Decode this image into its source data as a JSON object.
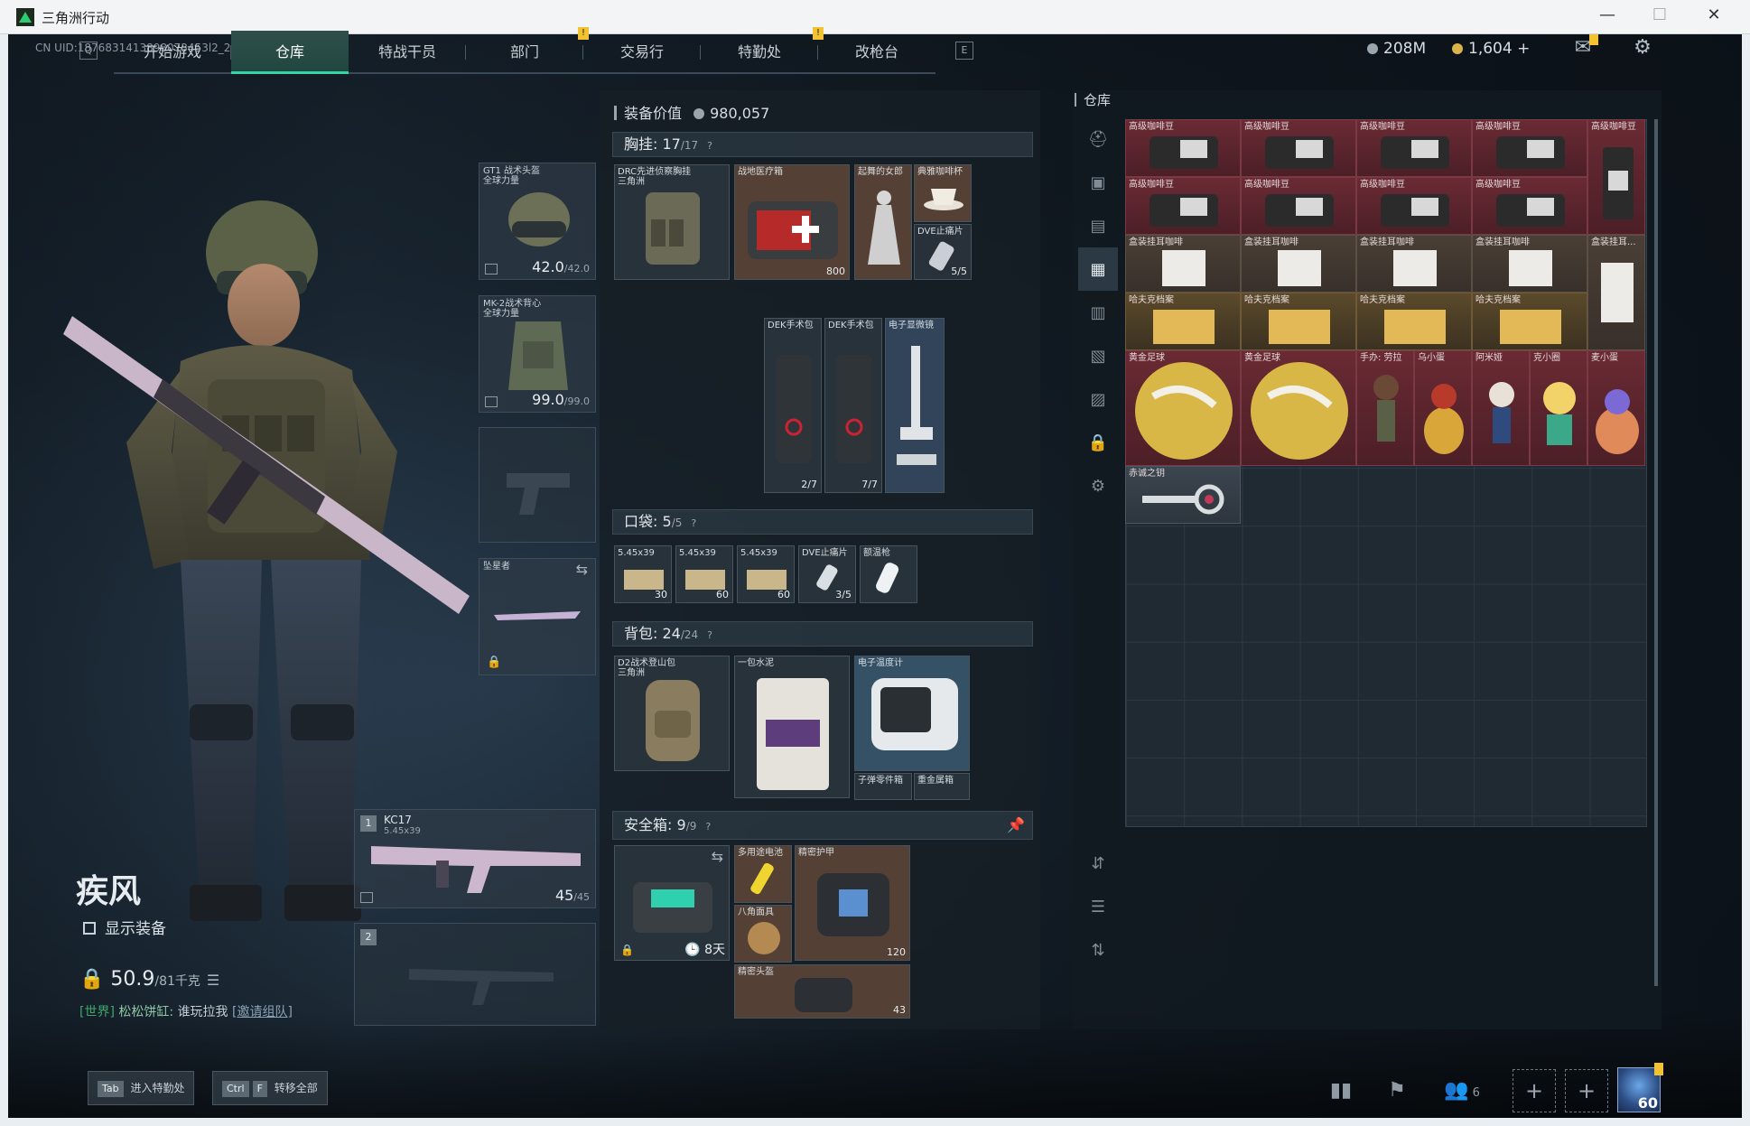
{
  "window": {
    "title": "三角洲行动",
    "controls": [
      "—",
      "☐",
      "✕"
    ]
  },
  "uid": "CN UID:1876831413898073453l2_202606180111",
  "nav": {
    "key_left": "Q",
    "key_right": "E",
    "tabs": [
      {
        "label": "开始游戏"
      },
      {
        "label": "仓库",
        "active": true
      },
      {
        "label": "特战干员"
      },
      {
        "label": "部门",
        "alert": "!"
      },
      {
        "label": "交易行"
      },
      {
        "label": "特勤处",
        "alert": "!"
      },
      {
        "label": "改枪台"
      }
    ]
  },
  "currency": {
    "silver": "208M",
    "gold": "1,604",
    "gold_plus": "+"
  },
  "character": {
    "name": "疾风",
    "show_equipment": "显示装备",
    "weight_value": "50.9",
    "weight_max": "/81千克",
    "chat": {
      "channel": "[世界]",
      "player": "松松饼缸:",
      "message": "谁玩拉我",
      "invite": "[邀请组队]"
    }
  },
  "equipment": {
    "helmet": {
      "label": "GT1 战术头盔\n全球力量",
      "value": "42.0",
      "max": "/42.0"
    },
    "armor": {
      "label": "MK-2战术背心\n全球力量",
      "value": "99.0",
      "max": "/99.0"
    },
    "pendant": {
      "label": "坠星者"
    },
    "primary": {
      "index": "1",
      "label": "KC17",
      "sub": "5.45x39",
      "ammo": "45",
      "ammo_max": "/45"
    },
    "secondary": {
      "index": "2"
    }
  },
  "loadout": {
    "value_label": "装备价值",
    "value": "980,057",
    "chest": {
      "label": "胸挂:",
      "count": "17",
      "max": "/17",
      "help": "?"
    },
    "pocket": {
      "label": "口袋:",
      "count": "5",
      "max": "/5",
      "help": "?"
    },
    "backpack": {
      "label": "背包:",
      "count": "24",
      "max": "/24",
      "help": "?"
    },
    "safebox": {
      "label": "安全箱:",
      "count": "9",
      "max": "/9",
      "help": "?",
      "timer": "8天"
    },
    "chest_items": [
      {
        "label": "DRC先进侦察胸挂\n三角洲"
      },
      {
        "label": "战地医疗箱",
        "count": "800"
      },
      {
        "label": "起舞的女郎"
      },
      {
        "label": "典雅咖啡杯"
      },
      {
        "label": "DVE止痛片",
        "count": "5/5"
      },
      {
        "label": "DEK手术包",
        "count": "2/7"
      },
      {
        "label": "DEK手术包",
        "count": "7/7"
      },
      {
        "label": "电子显微镜"
      }
    ],
    "pocket_items": [
      {
        "label": "5.45x39",
        "count": "30"
      },
      {
        "label": "5.45x39",
        "count": "60"
      },
      {
        "label": "5.45x39",
        "count": "60"
      },
      {
        "label": "DVE止痛片",
        "count": "3/5"
      },
      {
        "label": "额温枪"
      }
    ],
    "backpack_items": [
      {
        "label": "D2战术登山包\n三角洲"
      },
      {
        "label": "一包水泥"
      },
      {
        "label": "电子温度计"
      },
      {
        "label": "子弹零件箱"
      },
      {
        "label": "重金属箱"
      }
    ],
    "safebox_items": [
      {
        "label": "多用途电池"
      },
      {
        "label": "精密护甲",
        "count": "120"
      },
      {
        "label": "八角面具"
      },
      {
        "label": "精密头盔",
        "count": "43"
      }
    ]
  },
  "stash": {
    "title": "仓库",
    "items": [
      {
        "label": "高级咖啡豆"
      },
      {
        "label": "高级咖啡豆"
      },
      {
        "label": "高级咖啡豆"
      },
      {
        "label": "高级咖啡豆"
      },
      {
        "label": "高级咖啡豆"
      },
      {
        "label": "高级咖啡豆"
      },
      {
        "label": "高级咖啡豆"
      },
      {
        "label": "高级咖啡豆"
      },
      {
        "label": "高级咖啡豆"
      },
      {
        "label": "盒装挂耳咖啡"
      },
      {
        "label": "盒装挂耳咖啡"
      },
      {
        "label": "盒装挂耳咖啡"
      },
      {
        "label": "盒装挂耳咖啡"
      },
      {
        "label": "盒装挂耳..."
      },
      {
        "label": "哈夫克档案"
      },
      {
        "label": "哈夫克档案"
      },
      {
        "label": "哈夫克档案"
      },
      {
        "label": "哈夫克档案"
      },
      {
        "label": "黄金足球"
      },
      {
        "label": "黄金足球"
      },
      {
        "label": "手办: 劳拉"
      },
      {
        "label": "乌小蛋"
      },
      {
        "label": "阿米娅"
      },
      {
        "label": "克小圈"
      },
      {
        "label": "麦小蛋"
      },
      {
        "label": "赤诚之钥"
      }
    ]
  },
  "bottom": {
    "enter_key": "Tab",
    "enter_label": "进入特勤处",
    "transfer_key1": "Ctrl",
    "transfer_key2": "F",
    "transfer_label": "转移全部",
    "friends": "6",
    "level": "60"
  },
  "colors": {
    "accent": "#35d4a5",
    "alert": "#f2c233",
    "stash_red": "#6a2a33"
  }
}
